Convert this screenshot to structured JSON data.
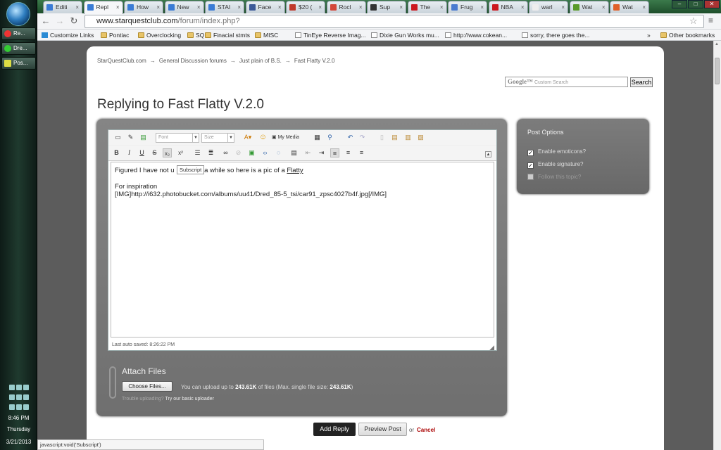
{
  "taskbar": {
    "buttons": [
      "Re...",
      "Dre...",
      "Pos..."
    ],
    "clock": {
      "time": "8:46 PM",
      "day": "Thursday",
      "date": "3/21/2013"
    }
  },
  "browser": {
    "tabs": [
      {
        "label": "Editi",
        "color": "#3a7bd5"
      },
      {
        "label": "Repl",
        "color": "#3a7bd5",
        "active": true
      },
      {
        "label": "How",
        "color": "#3a7bd5"
      },
      {
        "label": "New",
        "color": "#3a7bd5"
      },
      {
        "label": "STAI",
        "color": "#3a7bd5"
      },
      {
        "label": "Face",
        "color": "#3b5998"
      },
      {
        "label": "$20 (",
        "color": "#c0392b"
      },
      {
        "label": "Rocl",
        "color": "#d44638"
      },
      {
        "label": "Sup",
        "color": "#333333"
      },
      {
        "label": "The",
        "color": "#cc181e"
      },
      {
        "label": "Frug",
        "color": "#4a7bd0"
      },
      {
        "label": "NBA",
        "color": "#cc181e"
      },
      {
        "label": "warl",
        "color": "#eeeeee"
      },
      {
        "label": "Wat",
        "color": "#5a9a2a"
      },
      {
        "label": "Wat",
        "color": "#e0602a"
      }
    ],
    "url": {
      "host": "www.starquestclub.com",
      "path": "/forum/index.php?"
    },
    "bookmarks": [
      {
        "label": "Customize Links",
        "type": "grid"
      },
      {
        "label": "Pontiac",
        "type": "folder"
      },
      {
        "label": "Overclocking",
        "type": "folder"
      },
      {
        "label": "SQ",
        "type": "folder"
      },
      {
        "label": "Finacial stmts",
        "type": "folder"
      },
      {
        "label": "MISC",
        "type": "folder"
      },
      {
        "label": "TinEye Reverse Imag...",
        "type": "page"
      },
      {
        "label": "Dixie Gun Works mu...",
        "type": "page"
      },
      {
        "label": "http://www.cokean...",
        "type": "page"
      },
      {
        "label": "sorry, there goes the...",
        "type": "page"
      }
    ],
    "bookmarks_more": "»",
    "other_bookmarks": "Other bookmarks",
    "status_text": "javascript:void('Subscript')"
  },
  "page": {
    "breadcrumb": [
      "StarQuestClub.com",
      "General Discussion forums",
      "Just plain of B.S.",
      "Fast Flatty V.2.0"
    ],
    "breadcrumb_sep": "→",
    "search": {
      "brand": "Google™",
      "placeholder": "Custom Search",
      "button": "Search"
    },
    "title": "Replying to Fast Flatty V.2.0",
    "editor": {
      "font_placeholder": "Font",
      "size_placeholder": "Size",
      "my_media": "My Media",
      "tooltip": "Subscript",
      "line1_a": "Figured I have not u",
      "line1_b": " a while so here is a pic of a ",
      "line1_c": "Flatty",
      "line2": "For inspiration",
      "line3": "[IMG]http://i632.photobucket.com/albums/uu41/Dred_85-5_tsi/car91_zpsc4027b4f.jpg[/IMG]",
      "autosave": "Last auto saved: 8:26:22 PM"
    },
    "attach": {
      "title": "Attach Files",
      "choose_button": "Choose Files...",
      "info_prefix": "You can upload up to ",
      "info_size": "243.61K",
      "info_mid": " of files (Max. single file size: ",
      "info_max": "243.61K",
      "info_suffix": ")",
      "trouble": "Trouble uploading? ",
      "trouble_link": "Try our basic uploader"
    },
    "options": {
      "title": "Post Options",
      "items": [
        {
          "label": "Enable emoticons?",
          "checked": true
        },
        {
          "label": "Enable signature?",
          "checked": true
        },
        {
          "label": "Follow this topic?",
          "checked": false
        }
      ]
    },
    "actions": {
      "submit": "Add Reply",
      "preview": "Preview Post",
      "or": "or",
      "cancel": "Cancel"
    }
  }
}
